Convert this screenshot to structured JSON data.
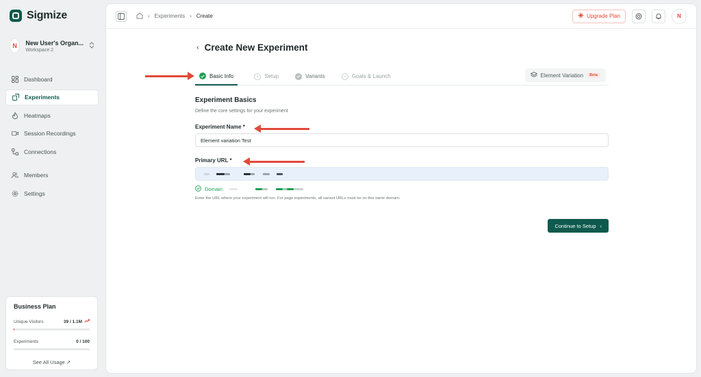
{
  "app": {
    "name": "Sigmize"
  },
  "org": {
    "avatar": "N",
    "name": "New User's Organ...",
    "workspace": "Workspace 2"
  },
  "sidebar": {
    "items": [
      {
        "label": "Dashboard",
        "icon": "dashboard-icon"
      },
      {
        "label": "Experiments",
        "icon": "experiments-icon",
        "active": true
      },
      {
        "label": "Heatmaps",
        "icon": "flame-icon"
      },
      {
        "label": "Session Recordings",
        "icon": "video-icon"
      },
      {
        "label": "Connections",
        "icon": "connections-icon"
      },
      {
        "label": "Members",
        "icon": "users-icon"
      },
      {
        "label": "Settings",
        "icon": "gear-icon"
      }
    ]
  },
  "plan": {
    "title": "Business Plan",
    "visitors_label": "Unique Visitors",
    "visitors_value": "39 / 1.1M",
    "visitors_fraction": 4e-05,
    "experiments_label": "Experiments",
    "experiments_value": "0 / 100",
    "experiments_fraction": 0,
    "link": "See All Usage"
  },
  "topbar": {
    "breadcrumb": [
      "Experiments",
      "Create"
    ],
    "upgrade": "Upgrade Plan",
    "avatar": "N"
  },
  "page": {
    "title": "Create New Experiment"
  },
  "steps": [
    {
      "label": "Basic Info",
      "state": "active"
    },
    {
      "label": "Setup",
      "state": "pending"
    },
    {
      "label": "Variants",
      "state": "done"
    },
    {
      "label": "Goals & Launch",
      "state": "pending"
    }
  ],
  "element_variation": {
    "label": "Element Variation",
    "badge": "Beta"
  },
  "form": {
    "section_title": "Experiment Basics",
    "section_desc": "Define the core settings for your experiment",
    "name_label": "Experiment Name *",
    "name_value": "Element variation Test",
    "url_label": "Primary URL *",
    "domain_label": "Domain:",
    "hint": "Enter the URL where your experiment will run. For page experiments, all variant URLs must be on this same domain.",
    "continue": "Continue to Setup"
  },
  "colors": {
    "brand": "#0f5a4e",
    "accent": "#e2493a",
    "success": "#1f9d55",
    "url_bg": "#e8f0fb"
  }
}
